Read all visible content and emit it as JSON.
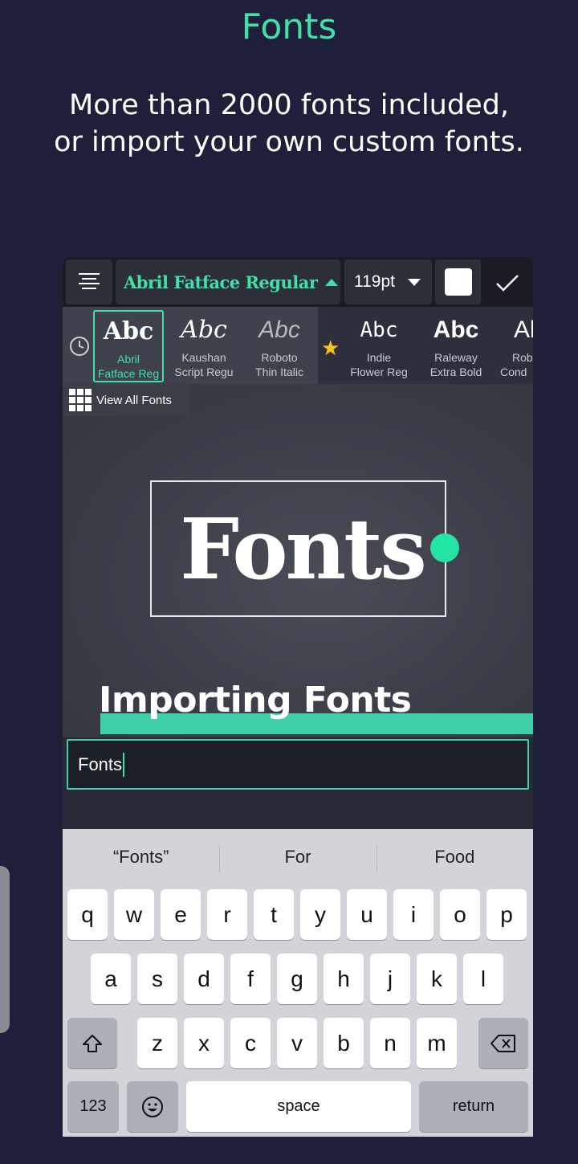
{
  "hero": {
    "title": "Fonts",
    "subtitle_line1": "More than 2000 fonts included,",
    "subtitle_line2": "or import your own custom fonts."
  },
  "colors": {
    "accent": "#40e0a8",
    "background": "#1e1f3b",
    "teal_bar": "#3fcfa9",
    "handle": "#22e5a4"
  },
  "toolbar": {
    "font_name": "Abril Fatface Regular",
    "font_size": "119pt",
    "align_icon": "align-center-icon",
    "confirm_icon": "checkmark-icon"
  },
  "font_strip": {
    "tiles": [
      {
        "sample": "Abc",
        "line1": "Abril",
        "line2": "Fatface Reg",
        "selected": true
      },
      {
        "sample": "Abc",
        "line1": "Kaushan",
        "line2": "Script Regu"
      },
      {
        "sample": "Abc",
        "line1": "Roboto",
        "line2": "Thin Italic"
      },
      {
        "sample": "Abc",
        "line1": "Indie",
        "line2": "Flower Reg"
      },
      {
        "sample": "Abc",
        "line1": "Raleway",
        "line2": "Extra Bold"
      },
      {
        "sample": "Al",
        "line1": "Rob",
        "line2": "Cond"
      }
    ],
    "recent_icon": "clock-icon",
    "favorites_icon": "star-icon",
    "view_all_label": "View All Fonts"
  },
  "canvas": {
    "main_text": "Fonts",
    "heading_text": "Importing Fonts"
  },
  "input": {
    "value": "Fonts"
  },
  "keyboard": {
    "suggestions": [
      "“Fonts”",
      "For",
      "Food"
    ],
    "row1": [
      "q",
      "w",
      "e",
      "r",
      "t",
      "y",
      "u",
      "i",
      "o",
      "p"
    ],
    "row2": [
      "a",
      "s",
      "d",
      "f",
      "g",
      "h",
      "j",
      "k",
      "l"
    ],
    "row3": [
      "z",
      "x",
      "c",
      "v",
      "b",
      "n",
      "m"
    ],
    "numbers_label": "123",
    "space_label": "space",
    "return_label": "return"
  }
}
